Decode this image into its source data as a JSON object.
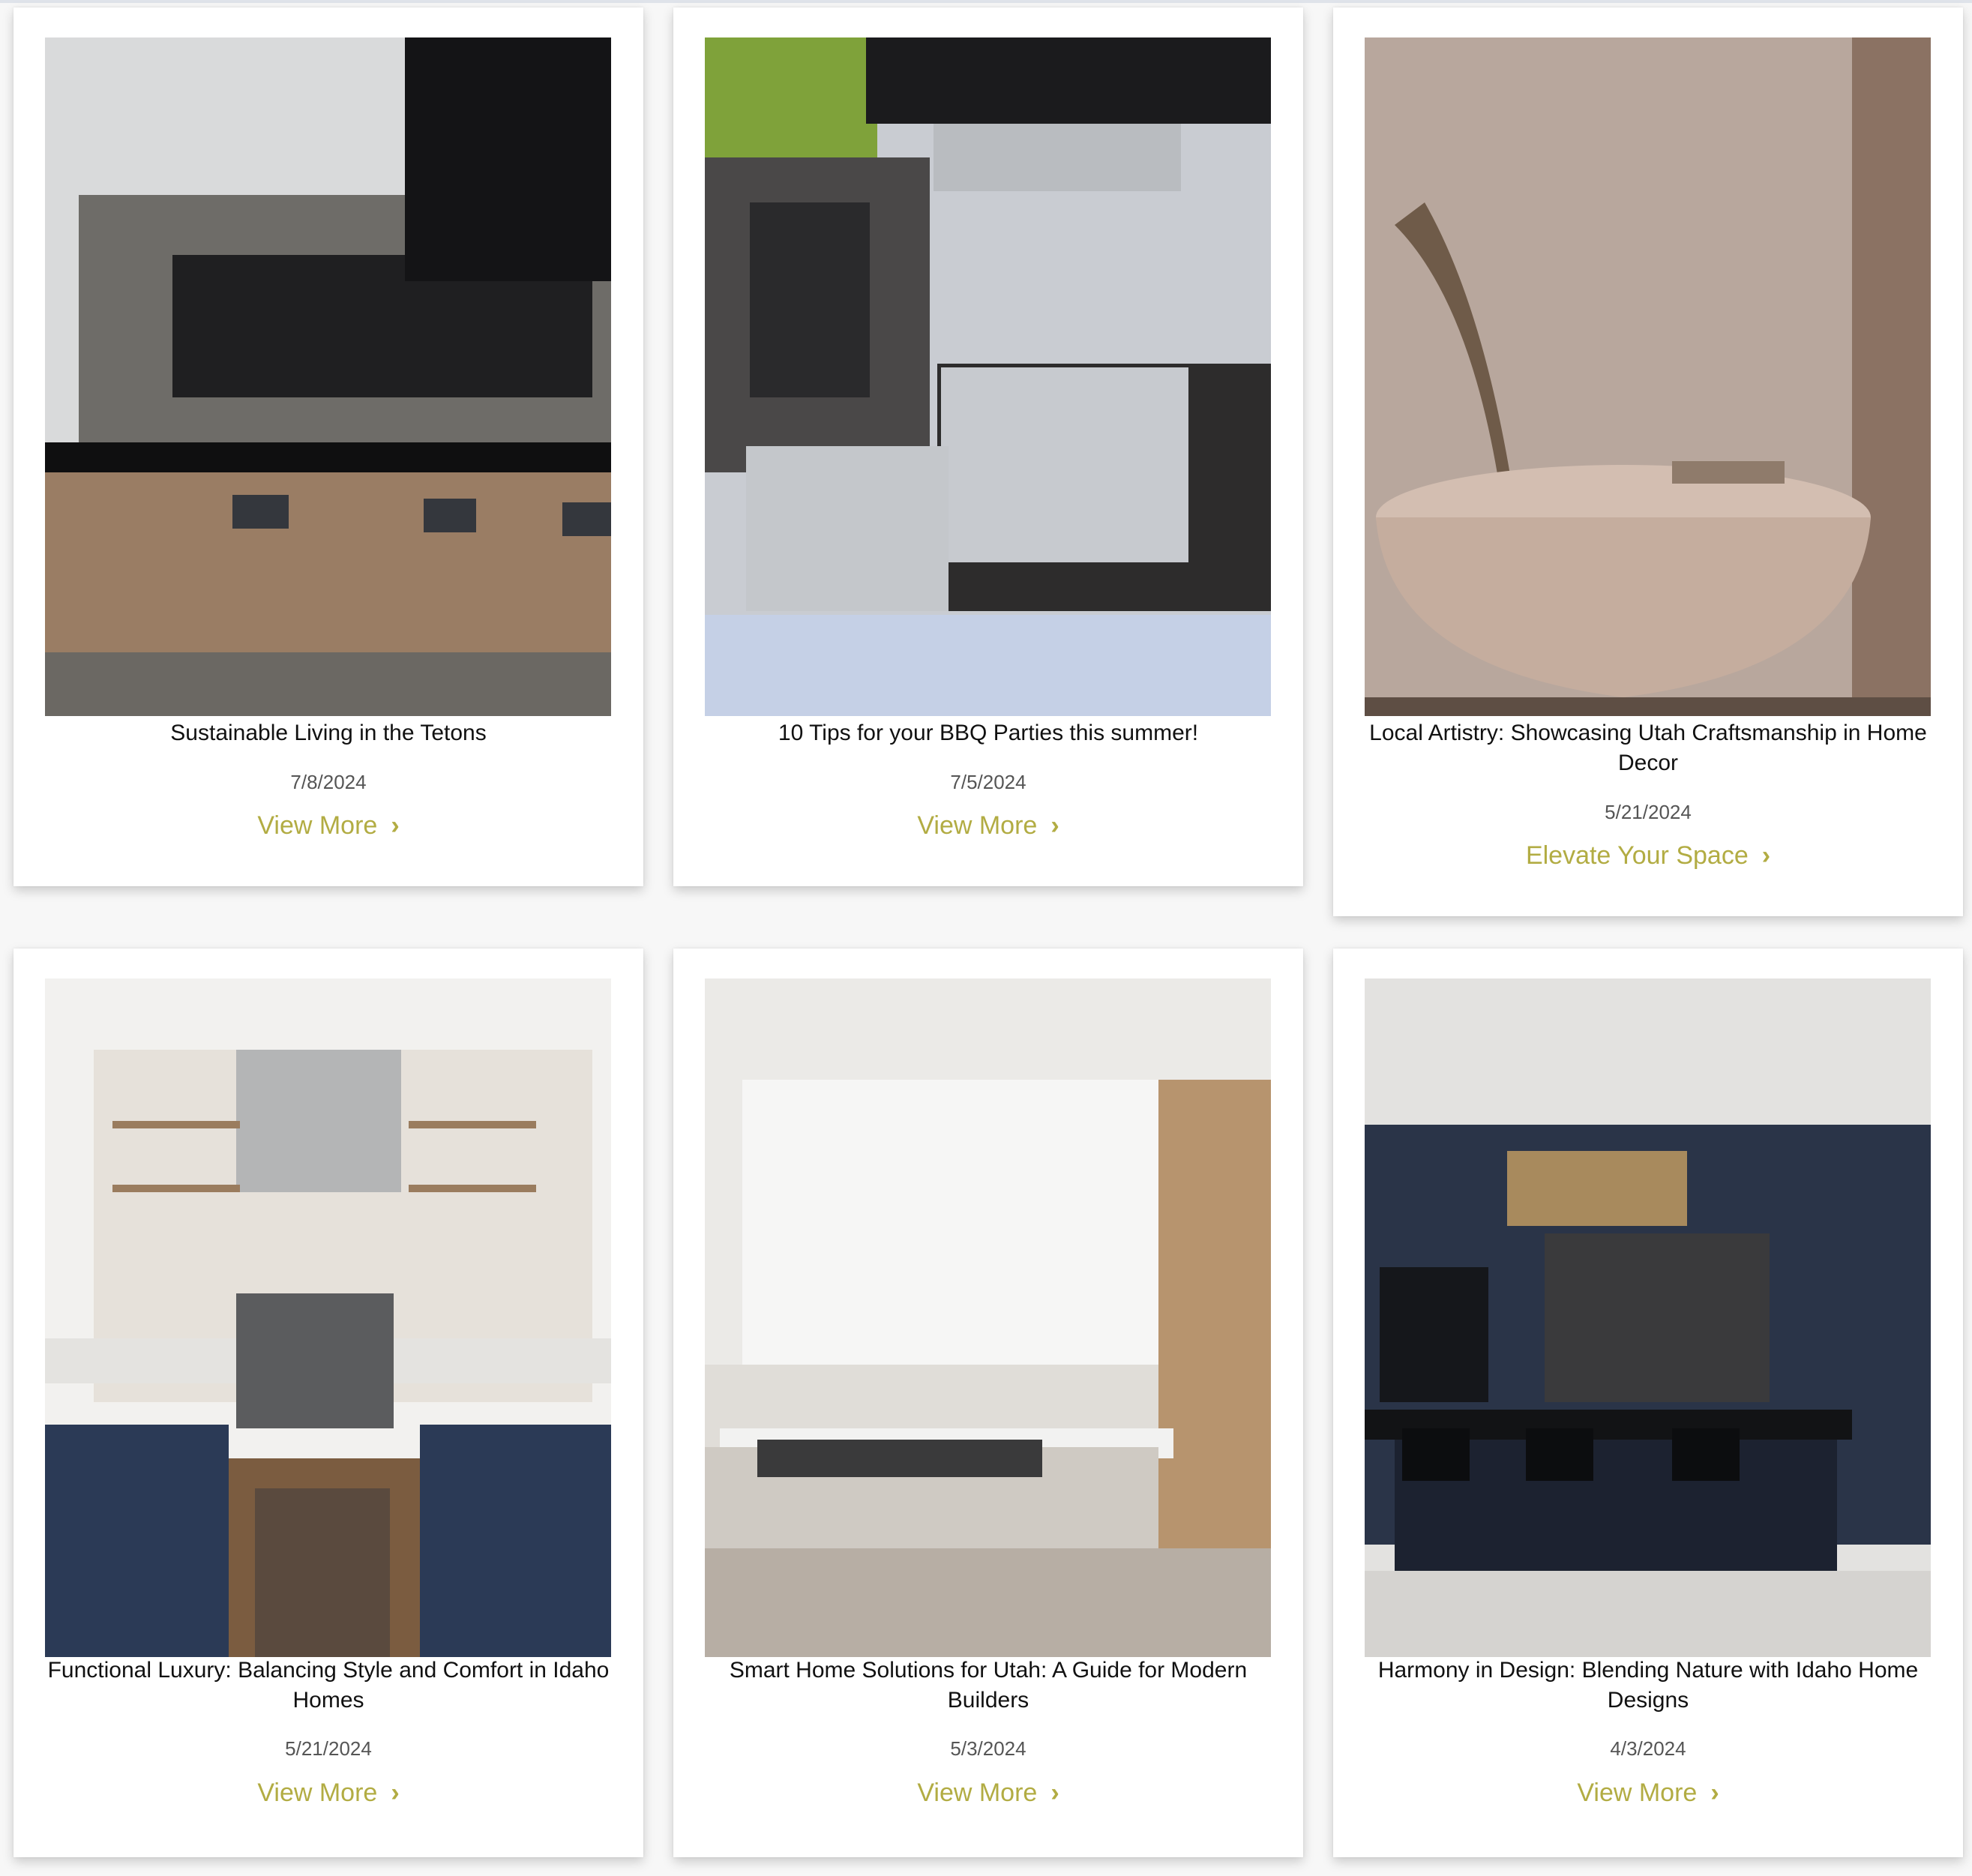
{
  "accent_color": "#b2ac43",
  "posts": [
    {
      "title": "Sustainable Living in the Tetons",
      "date": "7/8/2024",
      "link_label": "View More",
      "image_icon": "kitchen-photo"
    },
    {
      "title": "10 Tips for your BBQ Parties this summer!",
      "date": "7/5/2024",
      "link_label": "View More",
      "image_icon": "outdoor-grill-photo"
    },
    {
      "title": "Local Artistry: Showcasing Utah Craftsmanship in Home Decor",
      "date": "5/21/2024",
      "link_label": "Elevate Your Space",
      "image_icon": "bathtub-photo"
    },
    {
      "title": "Functional Luxury: Balancing Style and Comfort in Idaho Homes",
      "date": "5/21/2024",
      "link_label": "View More",
      "image_icon": "kitchen-photo"
    },
    {
      "title": "Smart Home Solutions for Utah: A Guide for Modern Builders",
      "date": "5/3/2024",
      "link_label": "View More",
      "image_icon": "kitchen-photo"
    },
    {
      "title": "Harmony in Design: Blending Nature with Idaho Home Designs",
      "date": "4/3/2024",
      "link_label": "View More",
      "image_icon": "kitchen-photo"
    }
  ]
}
